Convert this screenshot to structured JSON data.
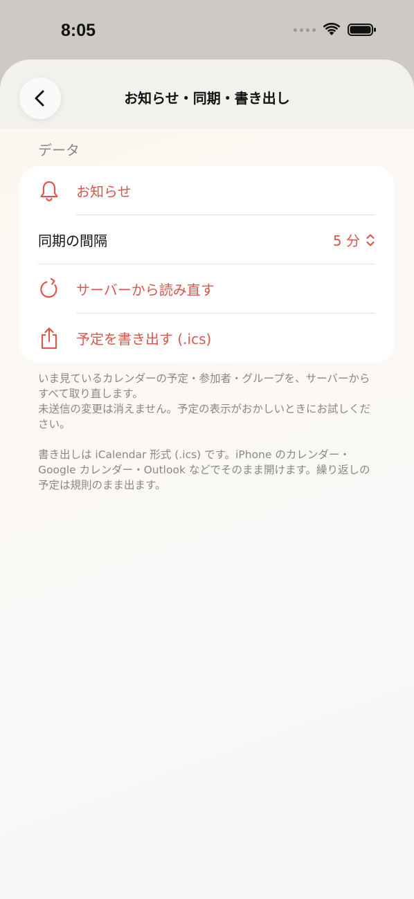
{
  "status_bar": {
    "time": "8:05"
  },
  "nav": {
    "title": "お知らせ・同期・書き出し",
    "back_icon": "chevron-left-icon"
  },
  "section": {
    "header": "データ"
  },
  "rows": {
    "notifications": {
      "label": "お知らせ",
      "icon": "bell-icon"
    },
    "sync_interval": {
      "label": "同期の間隔",
      "value": "5 分",
      "icon": "chevron-up-down-icon"
    },
    "reload": {
      "label": "サーバーから読み直す",
      "icon": "refresh-icon"
    },
    "export": {
      "label": "予定を書き出す (.ics)",
      "icon": "share-icon"
    }
  },
  "footer": {
    "paragraph1": "いま見ているカレンダーの予定・参加者・グループを、サーバーからすべて取り直します。\n未送信の変更は消えません。予定の表示がおかしいときにお試しください。",
    "paragraph2": "書き出しは iCalendar 形式 (.ics) です。iPhone のカレンダー・Google カレンダー・Outlook などでそのまま開けます。繰り返しの予定は規則のまま出ます。"
  },
  "colors": {
    "accent": "#d9574b",
    "text": "#111111",
    "secondary": "#8a8784"
  }
}
